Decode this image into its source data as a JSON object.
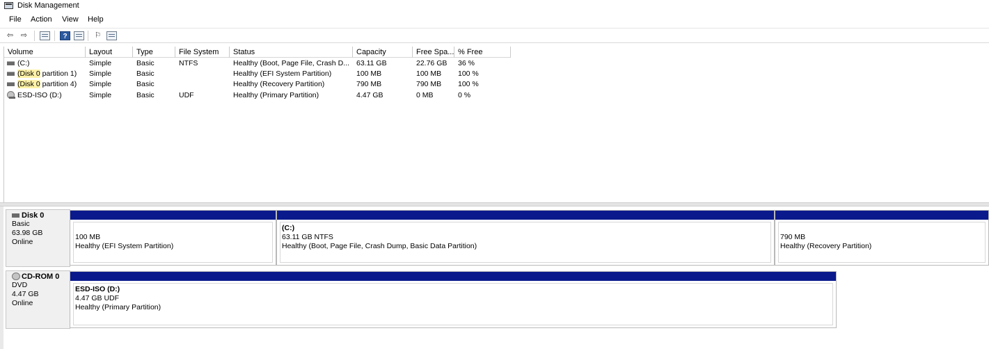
{
  "window": {
    "title": "Disk Management"
  },
  "menu": [
    "File",
    "Action",
    "View",
    "Help"
  ],
  "toolbar": {
    "back": "⇦",
    "forward": "⇨",
    "properties": "▦",
    "help": "?",
    "view": "▦",
    "connect": "⚐",
    "list": "☰"
  },
  "columns": [
    "Volume",
    "Layout",
    "Type",
    "File System",
    "Status",
    "Capacity",
    "Free Spa...",
    "% Free"
  ],
  "volumes": [
    {
      "volume": "(C:)",
      "layout": "Simple",
      "type": "Basic",
      "fs": "NTFS",
      "status": "Healthy (Boot, Page File, Crash D...",
      "capacity": "63.11 GB",
      "free": "22.76 GB",
      "pct": "36 %",
      "icon": "disk-volume-icon"
    },
    {
      "volume_hl": "(Disk 0",
      "volume_rest": " partition 1)",
      "layout": "Simple",
      "type": "Basic",
      "fs": "",
      "status": "Healthy (EFI System Partition)",
      "capacity": "100 MB",
      "free": "100 MB",
      "pct": "100 %",
      "icon": "disk-volume-icon"
    },
    {
      "volume_hl": "(Disk 0",
      "volume_rest": " partition 4)",
      "layout": "Simple",
      "type": "Basic",
      "fs": "",
      "status": "Healthy (Recovery Partition)",
      "capacity": "790 MB",
      "free": "790 MB",
      "pct": "100 %",
      "icon": "disk-volume-icon"
    },
    {
      "volume": "ESD-ISO (D:)",
      "layout": "Simple",
      "type": "Basic",
      "fs": "UDF",
      "status": "Healthy (Primary Partition)",
      "capacity": "4.47 GB",
      "free": "0 MB",
      "pct": "0 %",
      "icon": "cd-volume-icon"
    }
  ],
  "disks": [
    {
      "name": "Disk 0",
      "kind": "Basic",
      "size": "63.98 GB",
      "state": "Online",
      "partitions": [
        {
          "name": "",
          "size": "100 MB",
          "status": "Healthy (EFI System Partition)"
        },
        {
          "name": "(C:)",
          "size": "63.11 GB NTFS",
          "status": "Healthy (Boot, Page File, Crash Dump, Basic Data Partition)"
        },
        {
          "name": "",
          "size": "790 MB",
          "status": "Healthy (Recovery Partition)"
        }
      ]
    },
    {
      "name": "CD-ROM 0",
      "kind": "DVD",
      "size": "4.47 GB",
      "state": "Online",
      "partitions": [
        {
          "name": "ESD-ISO  (D:)",
          "size": "4.47 GB UDF",
          "status": "Healthy (Primary Partition)"
        }
      ]
    }
  ],
  "colors": {
    "partition_bar": "#0a1a8c",
    "highlight": "#fff2a8"
  }
}
